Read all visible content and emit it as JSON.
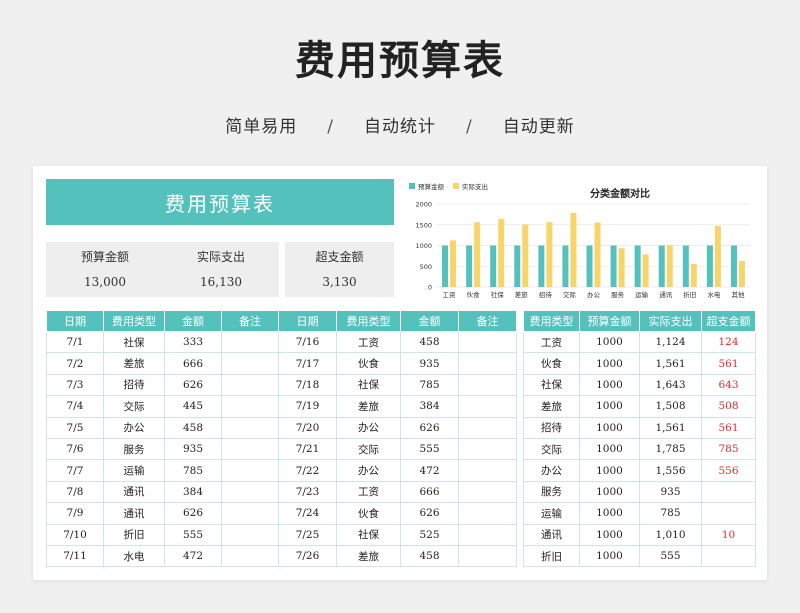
{
  "header": {
    "title": "费用预算表",
    "sub": [
      "简单易用",
      "自动统计",
      "自动更新"
    ],
    "sep": "/"
  },
  "sheet": {
    "title": "费用预算表",
    "stats": [
      {
        "label": "预算金额",
        "value": "13,000"
      },
      {
        "label": "实际支出",
        "value": "16,130"
      },
      {
        "label": "超支金额",
        "value": "3,130"
      }
    ]
  },
  "chart_data": {
    "type": "bar",
    "title": "分类金额对比",
    "categories": [
      "工资",
      "伙食",
      "社保",
      "差旅",
      "招待",
      "交际",
      "办公",
      "服务",
      "运输",
      "通讯",
      "折旧",
      "水电",
      "其他"
    ],
    "series": [
      {
        "name": "预算金额",
        "color": "#55c1bd",
        "values": [
          1000,
          1000,
          1000,
          1000,
          1000,
          1000,
          1000,
          1000,
          1000,
          1000,
          1000,
          1000,
          1000
        ]
      },
      {
        "name": "实际支出",
        "color": "#f7d56b",
        "values": [
          1124,
          1561,
          1643,
          1508,
          1561,
          1785,
          1556,
          935,
          785,
          1010,
          555,
          1472,
          625
        ]
      }
    ],
    "ylim": [
      0,
      2000
    ],
    "yticks": [
      "0",
      "500",
      "1000",
      "1500",
      "2000"
    ],
    "legend": "top-left",
    "grid": true
  },
  "table_left": {
    "headers": [
      "日期",
      "费用类型",
      "金额",
      "备注"
    ],
    "rows": [
      [
        "7/1",
        "社保",
        "333",
        ""
      ],
      [
        "7/2",
        "差旅",
        "666",
        ""
      ],
      [
        "7/3",
        "招待",
        "626",
        ""
      ],
      [
        "7/4",
        "交际",
        "445",
        ""
      ],
      [
        "7/5",
        "办公",
        "458",
        ""
      ],
      [
        "7/6",
        "服务",
        "935",
        ""
      ],
      [
        "7/7",
        "运输",
        "785",
        ""
      ],
      [
        "7/8",
        "通讯",
        "384",
        ""
      ],
      [
        "7/9",
        "通讯",
        "626",
        ""
      ],
      [
        "7/10",
        "折旧",
        "555",
        ""
      ],
      [
        "7/11",
        "水电",
        "472",
        ""
      ]
    ]
  },
  "table_mid": {
    "headers": [
      "日期",
      "费用类型",
      "金额",
      "备注"
    ],
    "rows": [
      [
        "7/16",
        "工资",
        "458",
        ""
      ],
      [
        "7/17",
        "伙食",
        "935",
        ""
      ],
      [
        "7/18",
        "社保",
        "785",
        ""
      ],
      [
        "7/19",
        "差旅",
        "384",
        ""
      ],
      [
        "7/20",
        "办公",
        "626",
        ""
      ],
      [
        "7/21",
        "交际",
        "555",
        ""
      ],
      [
        "7/22",
        "办公",
        "472",
        ""
      ],
      [
        "7/23",
        "工资",
        "666",
        ""
      ],
      [
        "7/24",
        "伙食",
        "626",
        ""
      ],
      [
        "7/25",
        "社保",
        "525",
        ""
      ],
      [
        "7/26",
        "差旅",
        "458",
        ""
      ]
    ]
  },
  "table_right": {
    "headers": [
      "费用类型",
      "预算金额",
      "实际支出",
      "超支金额"
    ],
    "rows": [
      [
        "工资",
        "1000",
        "1,124",
        "124"
      ],
      [
        "伙食",
        "1000",
        "1,561",
        "561"
      ],
      [
        "社保",
        "1000",
        "1,643",
        "643"
      ],
      [
        "差旅",
        "1000",
        "1,508",
        "508"
      ],
      [
        "招待",
        "1000",
        "1,561",
        "561"
      ],
      [
        "交际",
        "1000",
        "1,785",
        "785"
      ],
      [
        "办公",
        "1000",
        "1,556",
        "556"
      ],
      [
        "服务",
        "1000",
        "935",
        ""
      ],
      [
        "运输",
        "1000",
        "785",
        ""
      ],
      [
        "通讯",
        "1000",
        "1,010",
        "10"
      ],
      [
        "折旧",
        "1000",
        "555",
        ""
      ]
    ]
  }
}
